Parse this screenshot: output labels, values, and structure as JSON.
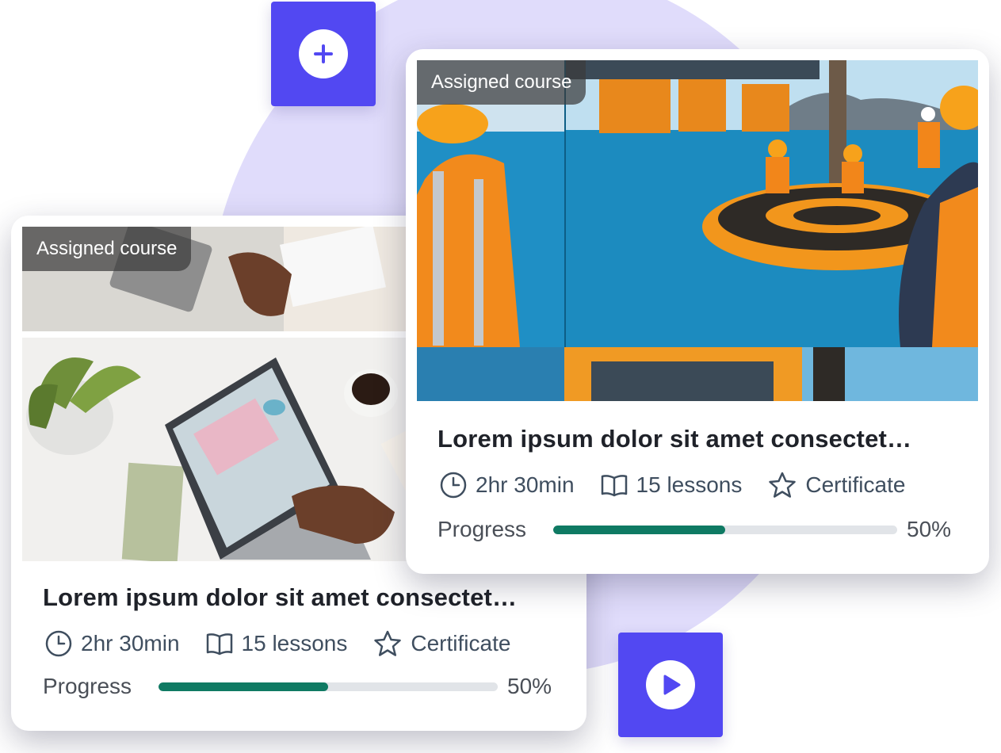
{
  "accent_color": "#5248f2",
  "progress_color": "#0f7a63",
  "buttons": {
    "add_icon": "plus-icon",
    "play_icon": "play-icon"
  },
  "cards": [
    {
      "badge": "Assigned course",
      "image": "office desk with laptop, calculator and coffee",
      "title": "Lorem ipsum dolor sit amet consectet…",
      "duration": "2hr 30min",
      "lessons": "15 lessons",
      "certificate": "Certificate",
      "progress_label": "Progress",
      "progress_value": 0.5,
      "progress_text": "50%"
    },
    {
      "badge": "Assigned course",
      "image": "offshore workers in orange safety gear at sea platform",
      "title": "Lorem ipsum dolor sit amet consectet…",
      "duration": "2hr 30min",
      "lessons": "15 lessons",
      "certificate": "Certificate",
      "progress_label": "Progress",
      "progress_value": 0.5,
      "progress_text": "50%"
    }
  ]
}
